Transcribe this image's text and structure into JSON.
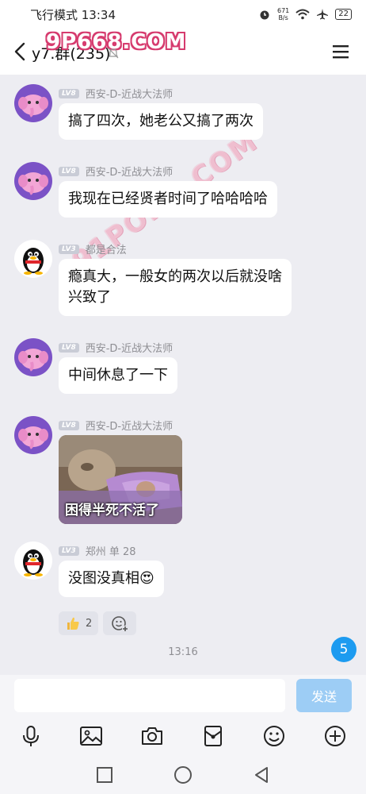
{
  "status_bar": {
    "left_text": "飞行模式 13:34",
    "net_speed_value": "671",
    "net_speed_unit": "B/s",
    "battery": "22"
  },
  "header": {
    "title": "y7.群(235)",
    "watermark_top": "9P668.COM"
  },
  "watermark_diag": "91PORN.COM",
  "messages": [
    {
      "sender": "西安-D-近战大法师",
      "level": "LV8",
      "avatar": "elephant-avatar",
      "text": "搞了四次，她老公又搞了两次"
    },
    {
      "sender": "西安-D-近战大法师",
      "level": "LV8",
      "avatar": "elephant-avatar",
      "text": "我现在已经贤者时间了哈哈哈哈"
    },
    {
      "sender": "都是合法",
      "level": "LV3",
      "avatar": "penguin-avatar",
      "text_line1": "瘾真大，一般女的两次以后就没啥",
      "text_line2": "兴致了"
    },
    {
      "sender": "西安-D-近战大法师",
      "level": "LV8",
      "avatar": "elephant-avatar",
      "text": "中间休息了一下"
    },
    {
      "sender": "西安-D-近战大法师",
      "level": "LV8",
      "avatar": "elephant-avatar",
      "image_caption": "困得半死不活了"
    },
    {
      "sender": "郑州 单 28",
      "level": "LV3",
      "avatar": "penguin-avatar",
      "text": "没图没真相😍"
    }
  ],
  "reactions": {
    "thumbs_up_count": "2"
  },
  "timestamp": "13:16",
  "unread_count": "5",
  "input": {
    "placeholder": "",
    "send_label": "发送"
  },
  "colors": {
    "accent": "#1d9bf0",
    "send_disabled": "#9dcdf5",
    "background": "#ededf2"
  }
}
